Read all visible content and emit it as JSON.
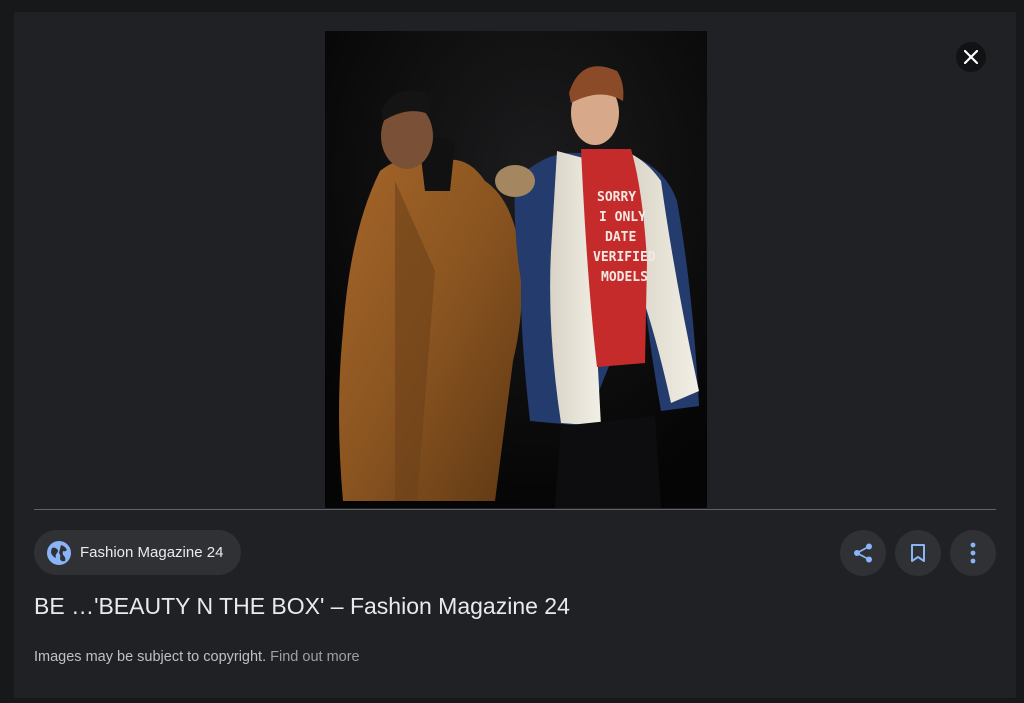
{
  "viewer": {
    "image": {
      "alt": "Two male models in winter coats posing against a black background",
      "shirt_text": [
        "SORRY",
        "I ONLY",
        "DATE",
        "VERIFIED",
        "MODELS"
      ]
    },
    "source": {
      "name": "Fashion Magazine 24",
      "icon": "globe-icon"
    },
    "title": "BE …'BEAUTY N THE BOX' – Fashion Magazine 24",
    "copyright": {
      "text": "Images may be subject to copyright.",
      "link": "Find out more"
    },
    "actions": {
      "share_icon": "share-icon",
      "save_icon": "bookmark-icon",
      "more_icon": "more-vert-icon",
      "close_icon": "close-icon"
    },
    "colors": {
      "panel_bg": "#202124",
      "chip_bg": "#303134",
      "accent_icon": "#8ab4f8",
      "text_primary": "#e8eaed"
    }
  }
}
